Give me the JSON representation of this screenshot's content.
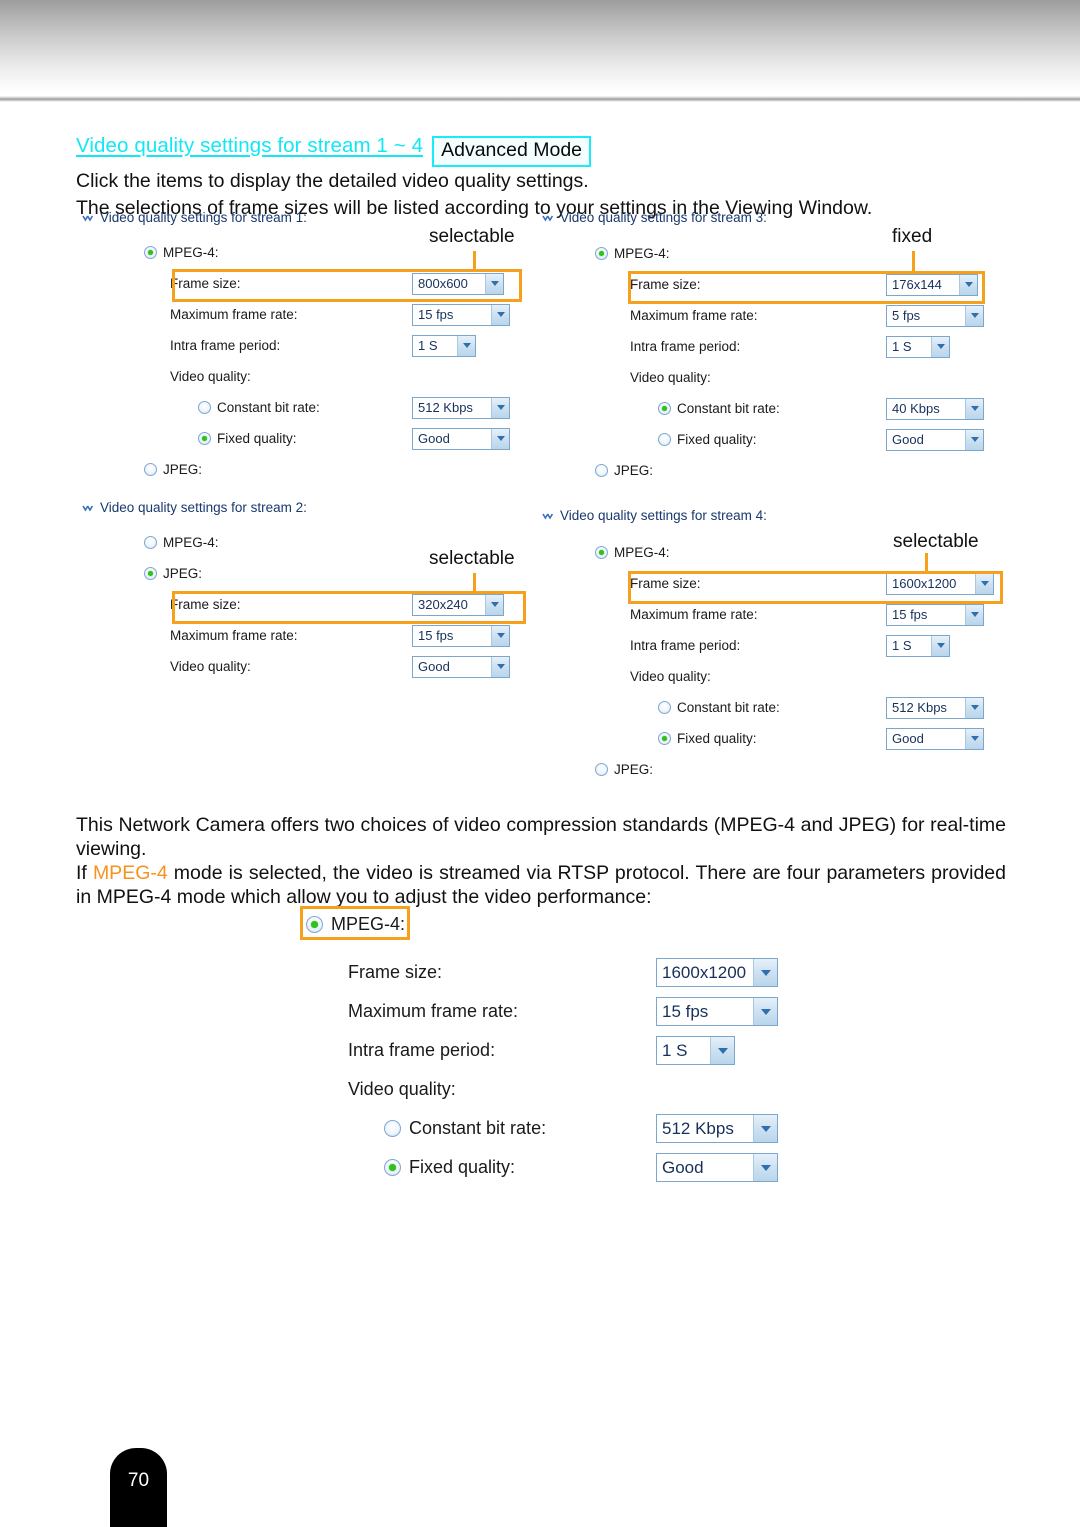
{
  "page": {
    "number": "70"
  },
  "intro": {
    "section_link": "Video quality settings for stream 1 ~ 4",
    "mode_badge": "Advanced Mode",
    "line1": "Click the items to display the detailed video quality settings.",
    "line2": "The selections of frame sizes will be listed according to your settings in the Viewing Window."
  },
  "labels": {
    "frame_size": "Frame size:",
    "max_frame_rate": "Maximum frame rate:",
    "intra_frame_period": "Intra frame period:",
    "video_quality": "Video quality:",
    "constant_bit_rate": "Constant bit rate:",
    "fixed_quality": "Fixed quality:",
    "mpeg4": "MPEG-4:",
    "jpeg": "JPEG:"
  },
  "streams": [
    {
      "id": "stream1",
      "header": "Video quality settings for stream 1:",
      "note": "selectable",
      "mpeg4_selected": true,
      "jpeg_selected": false,
      "frame_size": "800x600",
      "max_frame_rate": "15 fps",
      "intra_frame_period": "1 S",
      "constant_bit_rate_selected": false,
      "constant_bit_rate": "512 Kbps",
      "fixed_quality_selected": true,
      "fixed_quality": "Good"
    },
    {
      "id": "stream3",
      "header": "Video quality settings for stream 3:",
      "note": "fixed",
      "mpeg4_selected": true,
      "jpeg_selected": false,
      "frame_size": "176x144",
      "max_frame_rate": "5 fps",
      "intra_frame_period": "1 S",
      "constant_bit_rate_selected": true,
      "constant_bit_rate": "40 Kbps",
      "fixed_quality_selected": false,
      "fixed_quality": "Good"
    },
    {
      "id": "stream2",
      "header": "Video quality settings for stream 2:",
      "note": "selectable",
      "mpeg4_selected": false,
      "jpeg_selected": true,
      "frame_size": "320x240",
      "max_frame_rate": "15 fps",
      "video_quality": "Good"
    },
    {
      "id": "stream4",
      "header": "Video quality settings for stream 4:",
      "note": "selectable",
      "mpeg4_selected": true,
      "jpeg_selected": false,
      "frame_size": "1600x1200",
      "max_frame_rate": "15 fps",
      "intra_frame_period": "1 S",
      "constant_bit_rate_selected": false,
      "constant_bit_rate": "512 Kbps",
      "fixed_quality_selected": true,
      "fixed_quality": "Good"
    }
  ],
  "body": {
    "p1_a": "This Network Camera offers two choices of video compression standards (MPEG-4 and JPEG) for real-time viewing.",
    "p2_a": "If ",
    "p2_kw": "MPEG-4",
    "p2_b": " mode is selected, the video is streamed via RTSP protocol. There are four parameters provided in MPEG-4 mode which allow you to adjust the video performance:"
  },
  "big_panel": {
    "mpeg4": "MPEG-4:",
    "frame_size_label": "Frame size:",
    "frame_size": "1600x1200",
    "max_frame_rate_label": "Maximum frame rate:",
    "max_frame_rate": "15 fps",
    "intra_frame_period_label": "Intra frame period:",
    "intra_frame_period": "1 S",
    "video_quality_label": "Video quality:",
    "constant_bit_rate_label": "Constant bit rate:",
    "constant_bit_rate": "512 Kbps",
    "constant_bit_rate_selected": false,
    "fixed_quality_label": "Fixed quality:",
    "fixed_quality": "Good",
    "fixed_quality_selected": true
  },
  "colors": {
    "accent_orange": "#f5a11e",
    "link_cyan": "#12e8f4",
    "select_border": "#7ba7cc",
    "radio_green": "#2cc41a"
  }
}
